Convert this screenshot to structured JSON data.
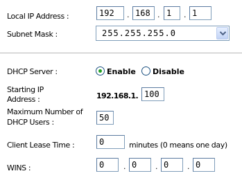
{
  "lan": {
    "local_ip_label": "Local IP Address :",
    "local_ip": [
      "192",
      "168",
      "1",
      "1"
    ],
    "ip_separator": ".",
    "subnet_label": "Subnet Mask :",
    "subnet_value": "255.255.255.0"
  },
  "dhcp": {
    "server_label": "DHCP Server :",
    "enable_label": "Enable",
    "disable_label": "Disable",
    "selected": "Enable",
    "starting_ip_label_1": "Starting IP",
    "starting_ip_label_2": "Address :",
    "starting_ip_prefix": "192.168.1.",
    "starting_ip_last": "100",
    "max_users_label_1": "Maximum Number of",
    "max_users_label_2": "DHCP Users :",
    "max_users": "50",
    "lease_label": "Client Lease Time :",
    "lease_value": "0",
    "lease_note": "minutes (0 means one day)",
    "wins_label": "WINS :",
    "wins": [
      "0",
      "0",
      "0",
      "0"
    ]
  },
  "icons": {
    "dropdown_arrow": "chevron-down-icon",
    "accent_color": "#21a121",
    "border_color": "#7f9db9"
  }
}
